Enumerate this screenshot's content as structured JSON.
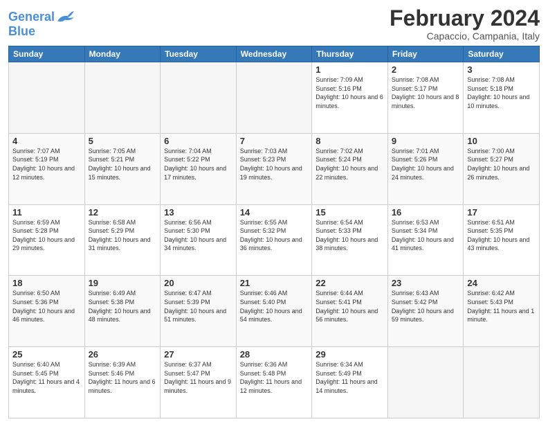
{
  "header": {
    "logo": {
      "line1": "General",
      "line2": "Blue"
    },
    "title": "February 2024",
    "subtitle": "Capaccio, Campania, Italy"
  },
  "days_of_week": [
    "Sunday",
    "Monday",
    "Tuesday",
    "Wednesday",
    "Thursday",
    "Friday",
    "Saturday"
  ],
  "weeks": [
    [
      {
        "day": "",
        "info": ""
      },
      {
        "day": "",
        "info": ""
      },
      {
        "day": "",
        "info": ""
      },
      {
        "day": "",
        "info": ""
      },
      {
        "day": "1",
        "info": "Sunrise: 7:09 AM\nSunset: 5:16 PM\nDaylight: 10 hours\nand 6 minutes."
      },
      {
        "day": "2",
        "info": "Sunrise: 7:08 AM\nSunset: 5:17 PM\nDaylight: 10 hours\nand 8 minutes."
      },
      {
        "day": "3",
        "info": "Sunrise: 7:08 AM\nSunset: 5:18 PM\nDaylight: 10 hours\nand 10 minutes."
      }
    ],
    [
      {
        "day": "4",
        "info": "Sunrise: 7:07 AM\nSunset: 5:19 PM\nDaylight: 10 hours\nand 12 minutes."
      },
      {
        "day": "5",
        "info": "Sunrise: 7:05 AM\nSunset: 5:21 PM\nDaylight: 10 hours\nand 15 minutes."
      },
      {
        "day": "6",
        "info": "Sunrise: 7:04 AM\nSunset: 5:22 PM\nDaylight: 10 hours\nand 17 minutes."
      },
      {
        "day": "7",
        "info": "Sunrise: 7:03 AM\nSunset: 5:23 PM\nDaylight: 10 hours\nand 19 minutes."
      },
      {
        "day": "8",
        "info": "Sunrise: 7:02 AM\nSunset: 5:24 PM\nDaylight: 10 hours\nand 22 minutes."
      },
      {
        "day": "9",
        "info": "Sunrise: 7:01 AM\nSunset: 5:26 PM\nDaylight: 10 hours\nand 24 minutes."
      },
      {
        "day": "10",
        "info": "Sunrise: 7:00 AM\nSunset: 5:27 PM\nDaylight: 10 hours\nand 26 minutes."
      }
    ],
    [
      {
        "day": "11",
        "info": "Sunrise: 6:59 AM\nSunset: 5:28 PM\nDaylight: 10 hours\nand 29 minutes."
      },
      {
        "day": "12",
        "info": "Sunrise: 6:58 AM\nSunset: 5:29 PM\nDaylight: 10 hours\nand 31 minutes."
      },
      {
        "day": "13",
        "info": "Sunrise: 6:56 AM\nSunset: 5:30 PM\nDaylight: 10 hours\nand 34 minutes."
      },
      {
        "day": "14",
        "info": "Sunrise: 6:55 AM\nSunset: 5:32 PM\nDaylight: 10 hours\nand 36 minutes."
      },
      {
        "day": "15",
        "info": "Sunrise: 6:54 AM\nSunset: 5:33 PM\nDaylight: 10 hours\nand 38 minutes."
      },
      {
        "day": "16",
        "info": "Sunrise: 6:53 AM\nSunset: 5:34 PM\nDaylight: 10 hours\nand 41 minutes."
      },
      {
        "day": "17",
        "info": "Sunrise: 6:51 AM\nSunset: 5:35 PM\nDaylight: 10 hours\nand 43 minutes."
      }
    ],
    [
      {
        "day": "18",
        "info": "Sunrise: 6:50 AM\nSunset: 5:36 PM\nDaylight: 10 hours\nand 46 minutes."
      },
      {
        "day": "19",
        "info": "Sunrise: 6:49 AM\nSunset: 5:38 PM\nDaylight: 10 hours\nand 48 minutes."
      },
      {
        "day": "20",
        "info": "Sunrise: 6:47 AM\nSunset: 5:39 PM\nDaylight: 10 hours\nand 51 minutes."
      },
      {
        "day": "21",
        "info": "Sunrise: 6:46 AM\nSunset: 5:40 PM\nDaylight: 10 hours\nand 54 minutes."
      },
      {
        "day": "22",
        "info": "Sunrise: 6:44 AM\nSunset: 5:41 PM\nDaylight: 10 hours\nand 56 minutes."
      },
      {
        "day": "23",
        "info": "Sunrise: 6:43 AM\nSunset: 5:42 PM\nDaylight: 10 hours\nand 59 minutes."
      },
      {
        "day": "24",
        "info": "Sunrise: 6:42 AM\nSunset: 5:43 PM\nDaylight: 11 hours\nand 1 minute."
      }
    ],
    [
      {
        "day": "25",
        "info": "Sunrise: 6:40 AM\nSunset: 5:45 PM\nDaylight: 11 hours\nand 4 minutes."
      },
      {
        "day": "26",
        "info": "Sunrise: 6:39 AM\nSunset: 5:46 PM\nDaylight: 11 hours\nand 6 minutes."
      },
      {
        "day": "27",
        "info": "Sunrise: 6:37 AM\nSunset: 5:47 PM\nDaylight: 11 hours\nand 9 minutes."
      },
      {
        "day": "28",
        "info": "Sunrise: 6:36 AM\nSunset: 5:48 PM\nDaylight: 11 hours\nand 12 minutes."
      },
      {
        "day": "29",
        "info": "Sunrise: 6:34 AM\nSunset: 5:49 PM\nDaylight: 11 hours\nand 14 minutes."
      },
      {
        "day": "",
        "info": ""
      },
      {
        "day": "",
        "info": ""
      }
    ]
  ]
}
